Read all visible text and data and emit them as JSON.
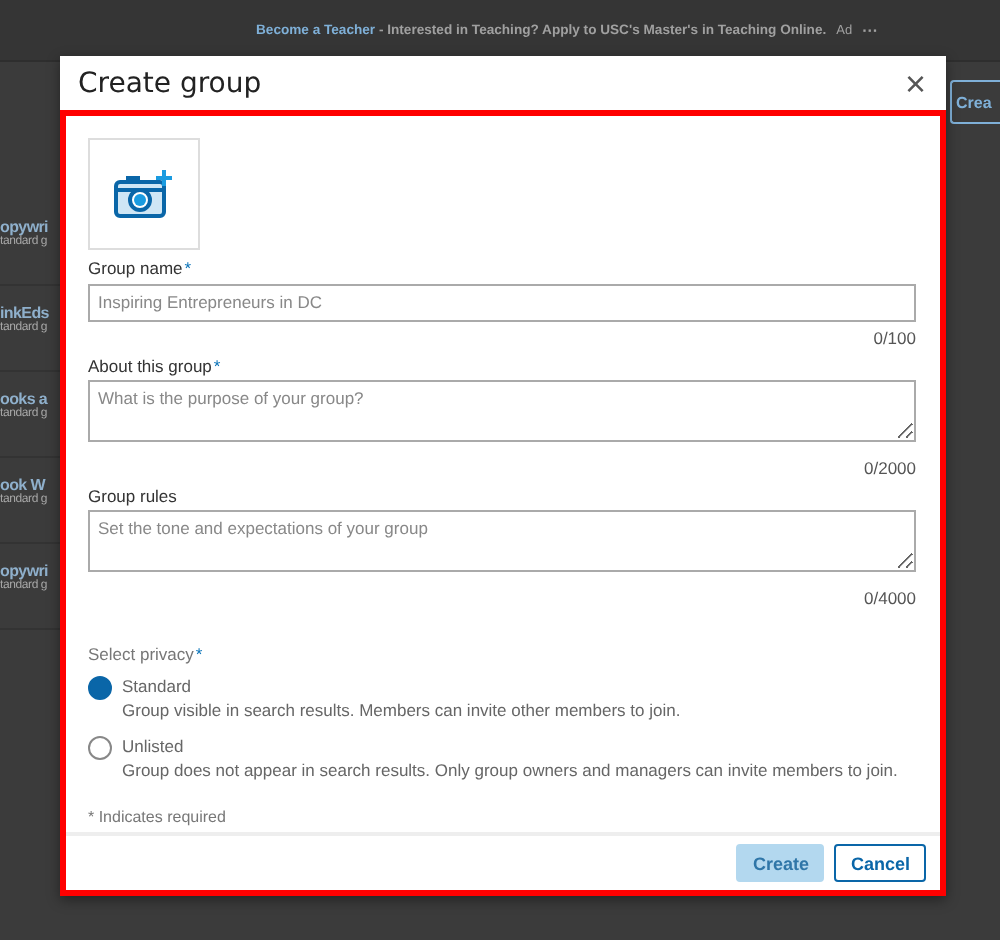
{
  "background_page": {
    "ad": {
      "link": "Become a Teacher",
      "text": " - Interested in Teaching? Apply to USC's Master's in Teaching Online.",
      "badge": "Ad",
      "menu": "···"
    },
    "create_button": "Crea",
    "groups": [
      {
        "name": "opywri",
        "subtitle": "tandard g"
      },
      {
        "name": "inkEds",
        "subtitle": "tandard g"
      },
      {
        "name": "ooks a",
        "subtitle": "tandard g"
      },
      {
        "name": "ook W",
        "subtitle": "tandard g"
      },
      {
        "name": "opywri",
        "subtitle": "tandard g"
      }
    ]
  },
  "dialog": {
    "title": "Create group",
    "close": "×",
    "fields": [
      {
        "kind": "input",
        "label": "Group name",
        "required_mark": "*",
        "placeholder": "Inspiring Entrepreneurs in DC",
        "counter": "0/100"
      },
      {
        "kind": "textarea",
        "label": "About this group",
        "required_mark": "*",
        "placeholder": "What is the purpose of your group?",
        "counter": "0/2000"
      },
      {
        "kind": "textarea",
        "label": "Group rules",
        "placeholder": "Set the tone and expectations of your group",
        "counter": "0/4000"
      }
    ],
    "privacy": {
      "label": "Select privacy",
      "required_mark": "*",
      "options": [
        {
          "label": "Standard",
          "description": "Group visible in search results. Members can invite other members to join.",
          "selected": true
        },
        {
          "label": "Unlisted",
          "description": "Group does not appear in search results. Only group owners and managers can invite members to join.",
          "selected": false
        }
      ]
    },
    "required_note": "* Indicates required",
    "buttons": [
      {
        "kind": "primary",
        "label": "Create",
        "disabled": true
      },
      {
        "kind": "secondary",
        "label": "Cancel",
        "disabled": false
      }
    ]
  }
}
